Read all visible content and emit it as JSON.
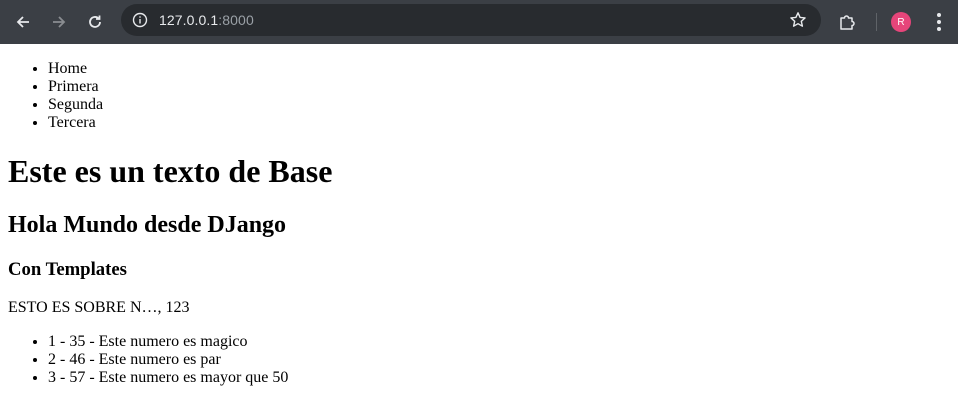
{
  "browser": {
    "url_host": "127.0.0.1",
    "url_port": ":8000",
    "avatar_initial": "R",
    "accent": "#e6457a"
  },
  "nav": [
    "Home",
    "Primera",
    "Segunda",
    "Tercera"
  ],
  "page": {
    "h1": "Este es un texto de Base",
    "h2": "Hola Mundo desde DJango",
    "h3": "Con Templates",
    "paragraph": "ESTO ES SOBRE N…, 123",
    "items": [
      "1 - 35 - Este numero es magico",
      "2 - 46 - Este numero es par",
      "3 - 57 - Este numero es mayor que 50"
    ]
  }
}
